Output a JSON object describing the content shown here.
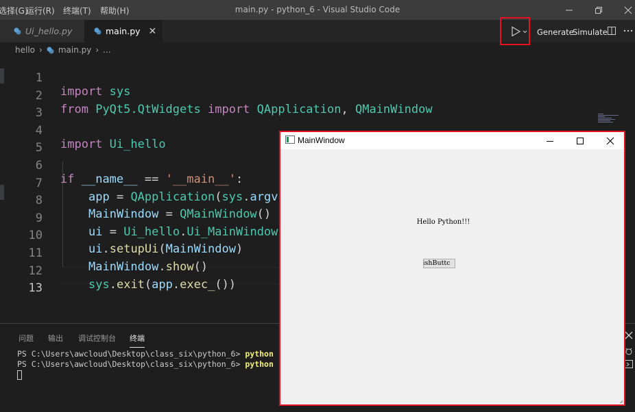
{
  "titlebar": {
    "menu": [
      "选择(G)",
      "运行(R)",
      "终端(T)",
      "帮助(H)"
    ],
    "title": "main.py - python_6 - Visual Studio Code"
  },
  "tabs": [
    {
      "label": "Ui_hello.py",
      "active": false
    },
    {
      "label": "main.py",
      "active": true
    }
  ],
  "toolbar": {
    "generate": "Generate",
    "simulate": "Simulate"
  },
  "breadcrumb": {
    "folder": "hello",
    "file": "main.py",
    "more": "..."
  },
  "editor": {
    "line_numbers": [
      "1",
      "2",
      "3",
      "4",
      "5",
      "6",
      "7",
      "8",
      "9",
      "10",
      "11",
      "12",
      "13"
    ],
    "lines": {
      "l1": [
        "import",
        " ",
        "sys"
      ],
      "l2": [
        "from",
        " ",
        "PyQt5.QtWidgets",
        " ",
        "import",
        " ",
        "QApplication",
        ", ",
        "QMainWindow"
      ],
      "l4": [
        "import",
        " ",
        "Ui_hello"
      ],
      "l6": [
        "if",
        " ",
        "__name__",
        " == ",
        "'__main__'",
        ":"
      ],
      "l7": [
        "app",
        " = ",
        "QApplication",
        "(",
        "sys",
        ".",
        "argv"
      ],
      "l8": [
        "MainWindow",
        " = ",
        "QMainWindow",
        "()"
      ],
      "l9": [
        "ui",
        " = ",
        "Ui_hello",
        ".",
        "Ui_MainWindow"
      ],
      "l10": [
        "ui",
        ".",
        "setupUi",
        "(",
        "MainWindow",
        ")"
      ],
      "l11": [
        "MainWindow",
        ".",
        "show",
        "()"
      ],
      "l12": [
        "sys",
        ".",
        "exit",
        "(",
        "app",
        ".",
        "exec_",
        "())"
      ]
    }
  },
  "panel": {
    "tabs": [
      "问题",
      "输出",
      "调试控制台",
      "终端"
    ],
    "terminal": {
      "prompt": "PS C:\\Users\\awcloud\\Desktop\\class_six\\python_6>",
      "command": "python"
    }
  },
  "qt_window": {
    "title": "MainWindow",
    "label": "Hello Python!!!",
    "button": "ishButtc"
  }
}
